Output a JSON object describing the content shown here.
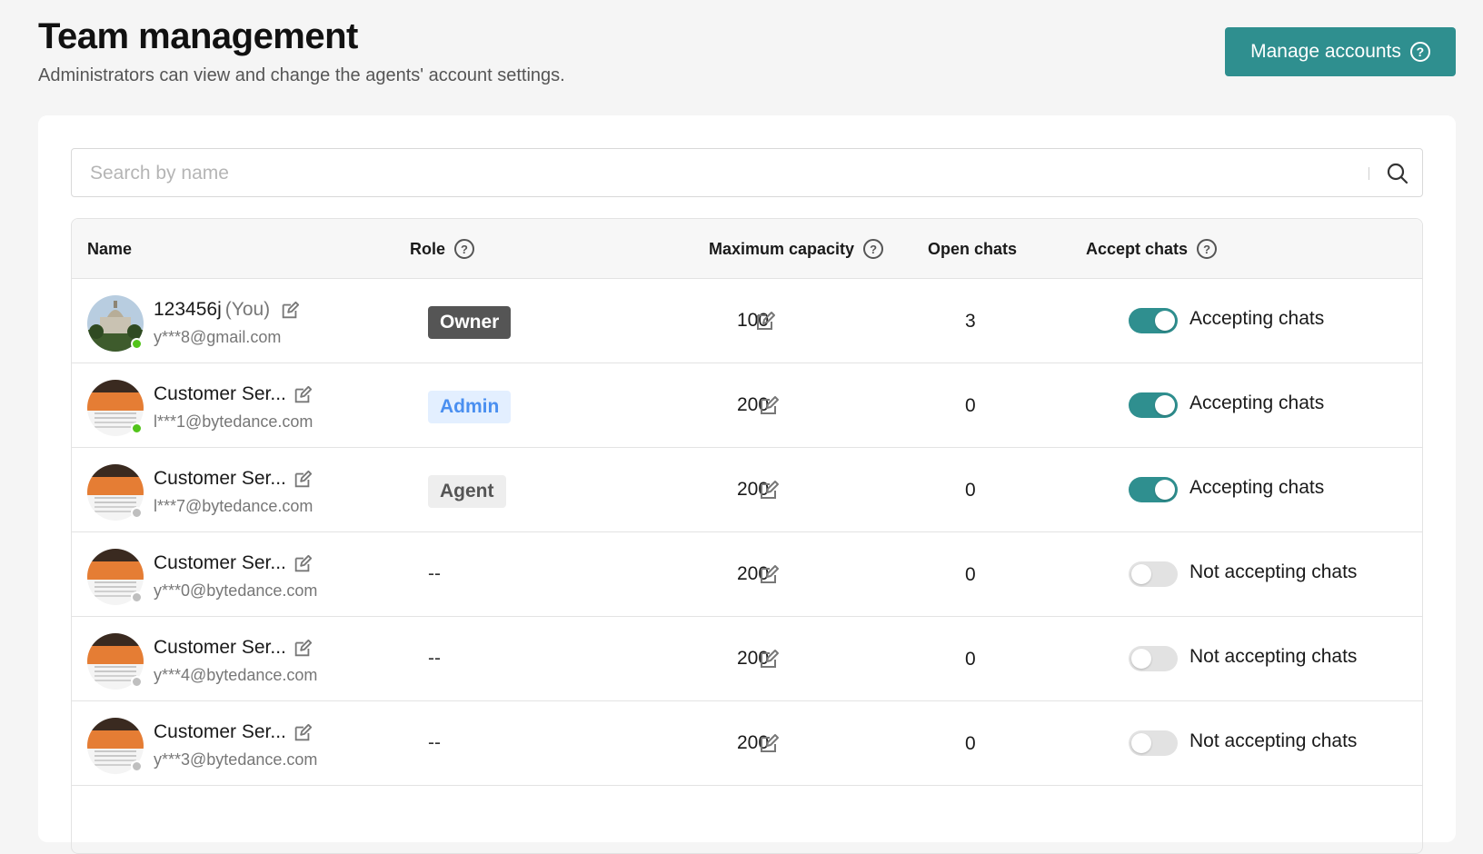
{
  "header": {
    "title": "Team management",
    "subtitle": "Administrators can view and change the agents' account settings.",
    "manage_button_label": "Manage accounts",
    "manage_button_icon": "question-circle-icon"
  },
  "search": {
    "placeholder": "Search by name",
    "value": ""
  },
  "table": {
    "headers": {
      "name": "Name",
      "role": "Role",
      "max_capacity": "Maximum capacity",
      "open_chats": "Open chats",
      "accept_chats": "Accept chats"
    },
    "rows": [
      {
        "name": "123456j",
        "you_label": "(You)",
        "email": "y***8@gmail.com",
        "avatar": "building-photo",
        "status": "online",
        "role": "Owner",
        "capacity": "100",
        "open_chats": "3",
        "accepting": true,
        "accept_label": "Accepting chats"
      },
      {
        "name": "Customer Ser...",
        "you_label": "",
        "email": "l***1@bytedance.com",
        "avatar": "store-banner",
        "status": "online",
        "role": "Admin",
        "capacity": "200",
        "open_chats": "0",
        "accepting": true,
        "accept_label": "Accepting chats"
      },
      {
        "name": "Customer Ser...",
        "you_label": "",
        "email": "l***7@bytedance.com",
        "avatar": "store-banner",
        "status": "offline",
        "role": "Agent",
        "capacity": "200",
        "open_chats": "0",
        "accepting": true,
        "accept_label": "Accepting chats"
      },
      {
        "name": "Customer Ser...",
        "you_label": "",
        "email": "y***0@bytedance.com",
        "avatar": "store-banner",
        "status": "offline",
        "role": "--",
        "capacity": "200",
        "open_chats": "0",
        "accepting": false,
        "accept_label": "Not accepting chats"
      },
      {
        "name": "Customer Ser...",
        "you_label": "",
        "email": "y***4@bytedance.com",
        "avatar": "store-banner",
        "status": "offline",
        "role": "--",
        "capacity": "200",
        "open_chats": "0",
        "accepting": false,
        "accept_label": "Not accepting chats"
      },
      {
        "name": "Customer Ser...",
        "you_label": "",
        "email": "y***3@bytedance.com",
        "avatar": "store-banner",
        "status": "offline",
        "role": "--",
        "capacity": "200",
        "open_chats": "0",
        "accepting": false,
        "accept_label": "Not accepting chats"
      }
    ]
  },
  "colors": {
    "accent": "#2f8f8f",
    "online": "#52c41a",
    "offline": "#bfbfbf",
    "owner_badge": "#555555",
    "admin_badge_bg": "#e3efff",
    "admin_badge_text": "#4a8ff0",
    "agent_badge_bg": "#eeeeee"
  }
}
